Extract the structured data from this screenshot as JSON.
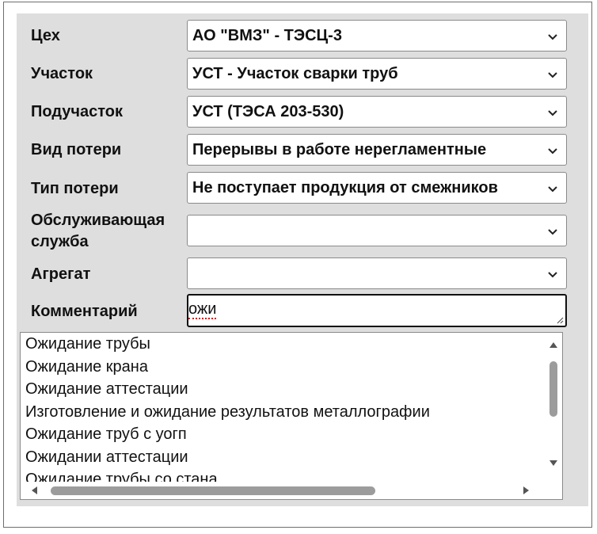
{
  "fields": [
    {
      "label": "Цех",
      "value": "АО \"ВМЗ\" - ТЭСЦ-3"
    },
    {
      "label": "Участок",
      "value": "УСТ - Участок сварки труб"
    },
    {
      "label": "Подучасток",
      "value": "УСТ (ТЭСА 203-530)"
    },
    {
      "label": "Вид потери",
      "value": "Перерывы в работе нерегламентные"
    },
    {
      "label": "Тип потери",
      "value": "Не поступает продукция от смежников"
    },
    {
      "label": "Обслуживающая служба",
      "value": ""
    },
    {
      "label": "Агрегат",
      "value": ""
    }
  ],
  "comment": {
    "label": "Комментарий",
    "value": "ожи"
  },
  "suggestions": [
    "Ожидание трубы",
    "Ожидание крана",
    "Ожидание аттестации",
    "Изготовление и ожидание результатов металлографии",
    "Ожидание труб с уогп",
    "Ожидании аттестации",
    "Ожидание трубы со стана"
  ],
  "icons": {
    "dropdown": "chevron-down-icon",
    "resize": "resize-grip-icon"
  }
}
